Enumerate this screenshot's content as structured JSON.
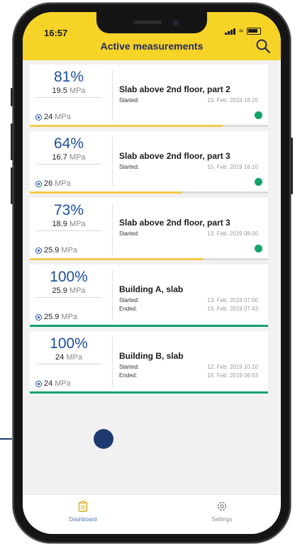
{
  "status": {
    "time": "16:57"
  },
  "header": {
    "title": "Active measurements",
    "search_icon": "search-icon"
  },
  "colors": {
    "accent": "#f5d327",
    "progress": "#f2c94c",
    "done": "#11a36a",
    "primary": "#1c4f9c"
  },
  "measurements": [
    {
      "percent": "81%",
      "progress": 0.81,
      "current_value": "19.5",
      "current_unit": "MPa",
      "target_value": "24",
      "target_unit": "MPa",
      "name": "Slab above 2nd floor, part 2",
      "started_label": "Started:",
      "started": "15. Feb. 2019 18:25",
      "status": "active"
    },
    {
      "percent": "64%",
      "progress": 0.64,
      "current_value": "16.7",
      "current_unit": "MPa",
      "target_value": "26",
      "target_unit": "MPa",
      "name": "Slab above 2nd floor, part 3",
      "started_label": "Started:",
      "started": "15. Feb. 2019 16:10",
      "status": "active"
    },
    {
      "percent": "73%",
      "progress": 0.73,
      "current_value": "18.9",
      "current_unit": "MPa",
      "target_value": "25.9",
      "target_unit": "MPa",
      "name": "Slab above 2nd floor, part 3",
      "started_label": "Started:",
      "started": "13. Feb. 2019 08:00",
      "status": "active"
    },
    {
      "percent": "100%",
      "progress": 1.0,
      "current_value": "25.9",
      "current_unit": "MPa",
      "target_value": "25.9",
      "target_unit": "MPa",
      "name": "Building A, slab",
      "started_label": "Started:",
      "started": "13. Feb. 2019 07:00",
      "ended_label": "Ended:",
      "ended": "15. Feb. 2019 07:43",
      "status": "done"
    },
    {
      "percent": "100%",
      "progress": 1.0,
      "current_value": "24",
      "current_unit": "MPa",
      "target_value": "24",
      "target_unit": "MPa",
      "name": "Building B, slab",
      "started_label": "Started:",
      "started": "12. Feb. 2019 10:10",
      "ended_label": "Ended:",
      "ended": "18. Feb. 2019 06:03",
      "status": "done"
    }
  ],
  "tabs": {
    "dashboard": "Dashboard",
    "settings": "Settings"
  }
}
